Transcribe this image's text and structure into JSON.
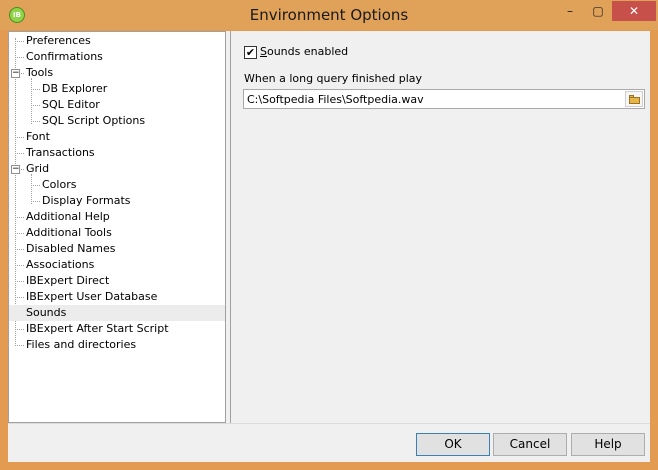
{
  "window": {
    "title": "Environment Options",
    "app_icon_text": "IB",
    "minimize_glyph": "–",
    "maximize_glyph": "▢",
    "close_glyph": "✕"
  },
  "tree": {
    "items": [
      {
        "label": "Preferences"
      },
      {
        "label": "Confirmations"
      },
      {
        "label": "Tools",
        "expander": "−"
      },
      {
        "label": "DB Explorer"
      },
      {
        "label": "SQL Editor"
      },
      {
        "label": "SQL Script Options"
      },
      {
        "label": "Font"
      },
      {
        "label": "Transactions"
      },
      {
        "label": "Grid",
        "expander": "−"
      },
      {
        "label": "Colors"
      },
      {
        "label": "Display Formats"
      },
      {
        "label": "Additional Help"
      },
      {
        "label": "Additional Tools"
      },
      {
        "label": "Disabled Names"
      },
      {
        "label": "Associations"
      },
      {
        "label": "IBExpert Direct"
      },
      {
        "label": "IBExpert User Database"
      },
      {
        "label": "Sounds",
        "selected": true
      },
      {
        "label": "IBExpert After Start Script"
      },
      {
        "label": "Files and directories"
      }
    ]
  },
  "sounds": {
    "checkbox_checked": true,
    "checkbox_mark": "✔",
    "checkbox_label_accel": "S",
    "checkbox_label_rest": "ounds enabled",
    "play_label": "When a long query finished play",
    "path_value": "C:\\Softpedia Files\\Softpedia.wav"
  },
  "buttons": {
    "ok": "OK",
    "cancel": "Cancel",
    "help": "Help"
  },
  "colors": {
    "titlebar": "#e0a159",
    "close_button": "#c7504a",
    "selection": "#ececec"
  }
}
